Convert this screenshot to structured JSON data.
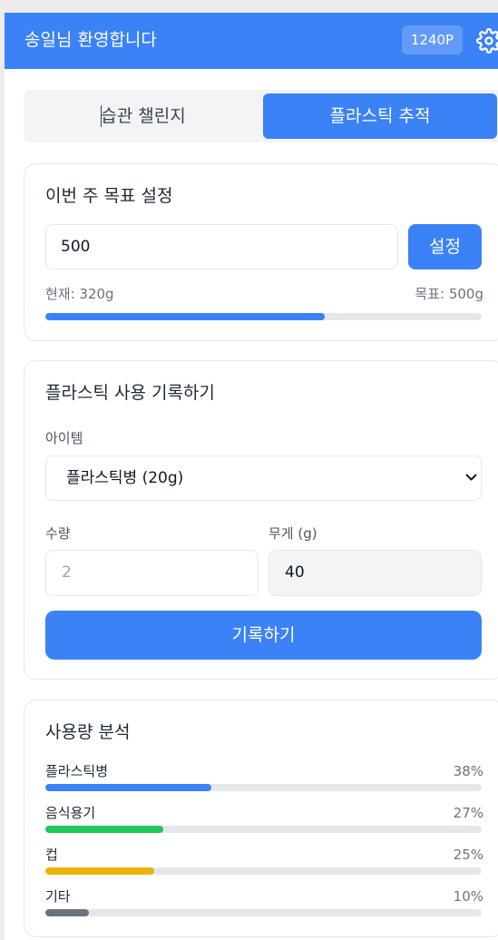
{
  "header": {
    "greeting": "송일님 환영합니다",
    "points": "1240P",
    "settings_icon": "gear-icon"
  },
  "tabs": [
    {
      "label": "습관 챌린지",
      "active": false
    },
    {
      "label": "플라스틱 추적",
      "active": true
    }
  ],
  "goal": {
    "title": "이번 주 목표 설정",
    "input_value": "500",
    "button_label": "설정",
    "current_label": "현재: 320g",
    "target_label": "목표: 500g",
    "progress": 0.64
  },
  "record": {
    "title": "플라스틱 사용 기록하기",
    "item_label": "아이템",
    "item_selected": "플라스틱병 (20g)",
    "quantity_label": "수량",
    "quantity_placeholder": "2",
    "weight_label": "무게 (g)",
    "weight_value": "40",
    "button_label": "기록하기"
  },
  "analysis": {
    "title": "사용량 분석",
    "rows": [
      {
        "label": "플라스틱병",
        "percent_text": "38%",
        "percent": 38,
        "color": "#3b82f6"
      },
      {
        "label": "음식용기",
        "percent_text": "27%",
        "percent": 27,
        "color": "#22c55e"
      },
      {
        "label": "컵",
        "percent_text": "25%",
        "percent": 25,
        "color": "#eab308"
      },
      {
        "label": "기타",
        "percent_text": "10%",
        "percent": 10,
        "color": "#6b7280"
      }
    ]
  },
  "colors": {
    "primary": "#3b82f6",
    "header_text": "#ffffff"
  }
}
